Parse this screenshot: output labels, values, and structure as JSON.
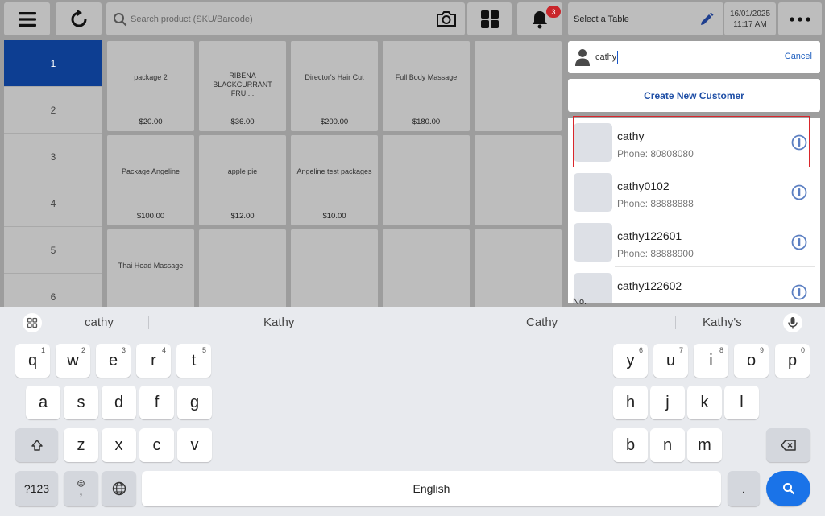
{
  "topbar": {
    "search_placeholder": "Search product (SKU/Barcode)",
    "notification_count": "3",
    "table_label": "Select a Table",
    "date": "16/01/2025",
    "time": "11:17 AM"
  },
  "table_numbers": [
    "1",
    "2",
    "3",
    "4",
    "5",
    "6"
  ],
  "products": [
    {
      "name": "package 2",
      "price": "$20.00"
    },
    {
      "name": "RIBENA BLACKCURRANT FRUI...",
      "price": "$36.00"
    },
    {
      "name": "Director's Hair Cut",
      "price": "$200.00"
    },
    {
      "name": "Full Body Massage",
      "price": "$180.00"
    },
    {
      "name": "",
      "price": ""
    },
    {
      "name": "Package Angeline",
      "price": "$100.00"
    },
    {
      "name": "apple pie",
      "price": "$12.00"
    },
    {
      "name": "Angeline test packages",
      "price": "$10.00"
    },
    {
      "name": "",
      "price": ""
    },
    {
      "name": "",
      "price": ""
    },
    {
      "name": "Thai Head Massage",
      "price": ""
    }
  ],
  "customer_panel": {
    "search_value": "cathy",
    "cancel_label": "Cancel",
    "create_label": "Create New Customer",
    "customers": [
      {
        "name": "cathy",
        "phone": "Phone: 80808080"
      },
      {
        "name": "cathy0102",
        "phone": "Phone: 88888888"
      },
      {
        "name": "cathy122601",
        "phone": "Phone: 88888900"
      },
      {
        "name": "cathy122602",
        "phone": ""
      }
    ],
    "peek_text": "No."
  },
  "keyboard": {
    "suggestions": [
      "cathy",
      "Kathy",
      "Cathy",
      "Kathy's"
    ],
    "row1": [
      {
        "k": "q",
        "s": "1"
      },
      {
        "k": "w",
        "s": "2"
      },
      {
        "k": "e",
        "s": "3"
      },
      {
        "k": "r",
        "s": "4"
      },
      {
        "k": "t",
        "s": "5"
      },
      {
        "k": "y",
        "s": "6"
      },
      {
        "k": "u",
        "s": "7"
      },
      {
        "k": "i",
        "s": "8"
      },
      {
        "k": "o",
        "s": "9"
      },
      {
        "k": "p",
        "s": "0"
      }
    ],
    "row2": [
      "a",
      "s",
      "d",
      "f",
      "g",
      "h",
      "j",
      "k",
      "l"
    ],
    "row3": [
      "z",
      "x",
      "c",
      "v",
      "b",
      "n",
      "m"
    ],
    "symbols_label": "?123",
    "comma_label": ",",
    "space_label": "English",
    "period_label": ".",
    "accent_color": "#1a73e8"
  }
}
